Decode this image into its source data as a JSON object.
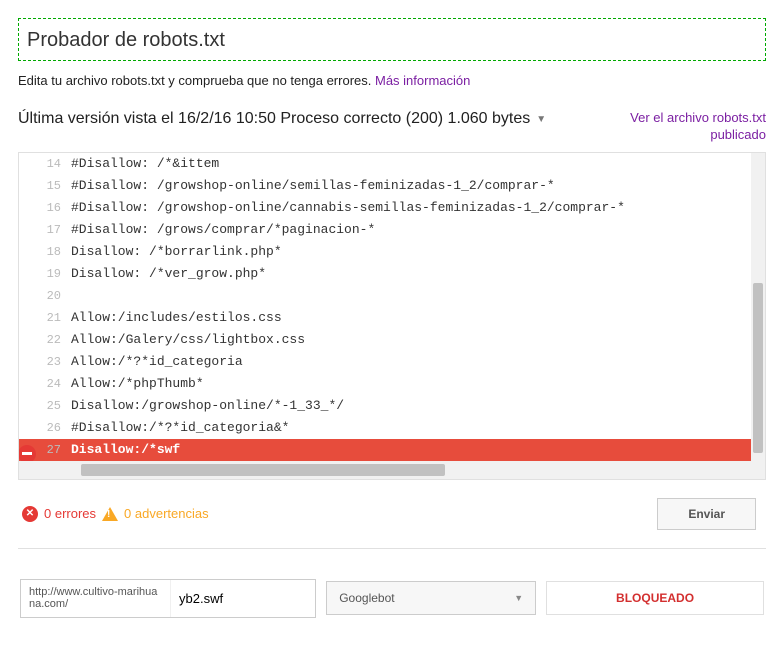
{
  "header": {
    "title": "Probador de robots.txt"
  },
  "subtitle": {
    "text": "Edita tu archivo robots.txt y comprueba que no tenga errores. ",
    "link": "Más información"
  },
  "status": {
    "line": "Última versión vista el 16/2/16 10:50 Proceso correcto (200) 1.060 bytes",
    "archive_link": "Ver el archivo robots.txt publicado"
  },
  "lines": [
    {
      "n": 14,
      "t": "#Disallow: /*&ittem"
    },
    {
      "n": 15,
      "t": "#Disallow: /growshop-online/semillas-feminizadas-1_2/comprar-*"
    },
    {
      "n": 16,
      "t": "#Disallow: /growshop-online/cannabis-semillas-feminizadas-1_2/comprar-*"
    },
    {
      "n": 17,
      "t": "#Disallow: /grows/comprar/*paginacion-*"
    },
    {
      "n": 18,
      "t": "Disallow: /*borrarlink.php*"
    },
    {
      "n": 19,
      "t": "Disallow: /*ver_grow.php*"
    },
    {
      "n": 20,
      "t": ""
    },
    {
      "n": 21,
      "t": "Allow:/includes/estilos.css"
    },
    {
      "n": 22,
      "t": "Allow:/Galery/css/lightbox.css"
    },
    {
      "n": 23,
      "t": "Allow:/*?*id_categoria"
    },
    {
      "n": 24,
      "t": "Allow:/*phpThumb*"
    },
    {
      "n": 25,
      "t": "Disallow:/growshop-online/*-1_33_*/"
    },
    {
      "n": 26,
      "t": "#Disallow:/*?*id_categoria&*"
    },
    {
      "n": 27,
      "t": "Disallow:/*swf",
      "error": true
    }
  ],
  "counts": {
    "errors_num": "0",
    "errors_label": "errores",
    "warns_num": "0",
    "warns_label": "advertencias"
  },
  "actions": {
    "submit": "Enviar"
  },
  "test": {
    "prefix": "http://www.cultivo-marihuana.com/",
    "value": "yb2.swf",
    "bot": "Googlebot",
    "result": "BLOQUEADO"
  }
}
